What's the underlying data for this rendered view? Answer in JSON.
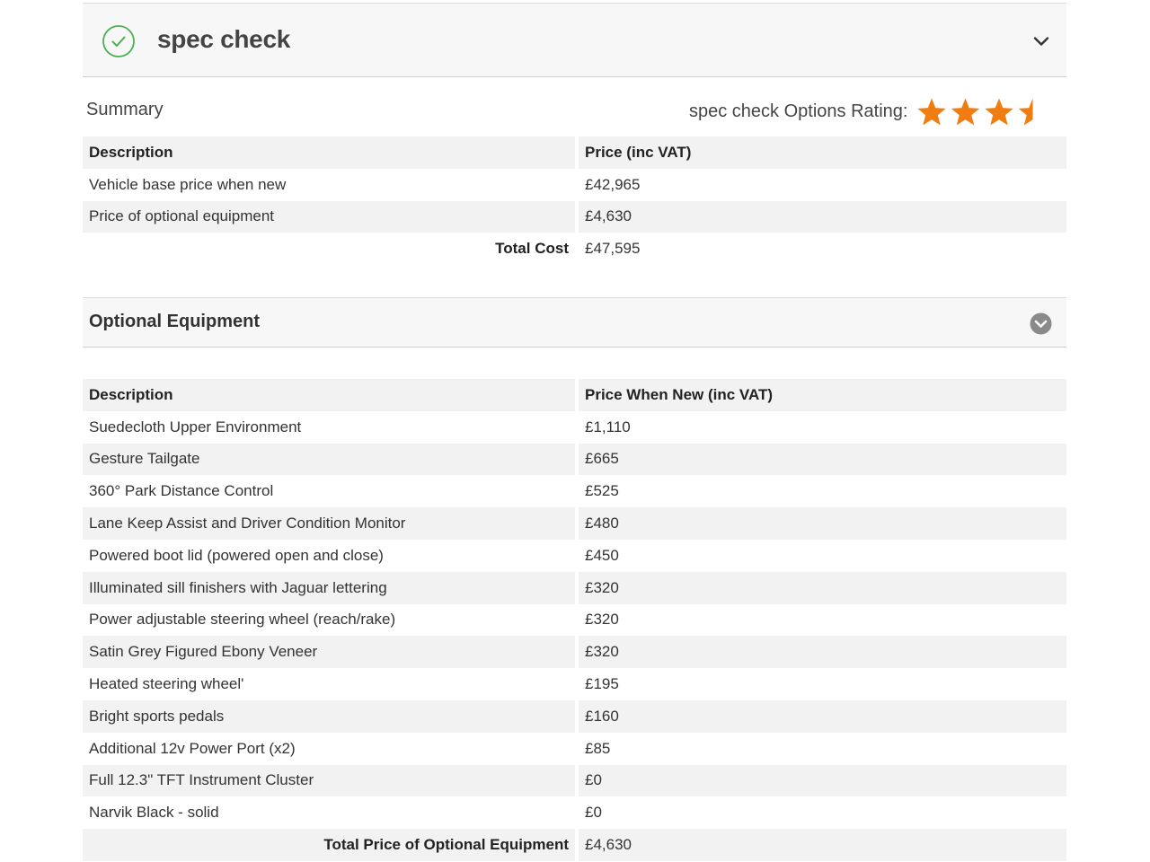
{
  "header": {
    "title": "spec check"
  },
  "summary": {
    "label": "Summary",
    "rating_label": "spec check Options Rating:",
    "rating": 3.5,
    "rating_max": 4,
    "columns": [
      "Description",
      "Price (inc VAT)"
    ],
    "rows": [
      {
        "desc": "Vehicle base price when new",
        "price": "£42,965"
      },
      {
        "desc": "Price of optional equipment",
        "price": "£4,630"
      }
    ],
    "total_label": "Total Cost",
    "total_value": "£47,595"
  },
  "optional": {
    "title": "Optional Equipment",
    "columns": [
      "Description",
      "Price When New (inc VAT)"
    ],
    "rows": [
      {
        "desc": "Suedecloth Upper Environment",
        "price": "£1,110"
      },
      {
        "desc": "Gesture Tailgate",
        "price": "£665"
      },
      {
        "desc": "360° Park Distance Control",
        "price": "£525"
      },
      {
        "desc": "Lane Keep Assist and Driver Condition Monitor",
        "price": "£480"
      },
      {
        "desc": "Powered boot lid (powered open and close)",
        "price": "£450"
      },
      {
        "desc": "Illuminated sill finishers with Jaguar lettering",
        "price": "£320"
      },
      {
        "desc": "Power adjustable steering wheel (reach/rake)",
        "price": "£320"
      },
      {
        "desc": "Satin Grey Figured Ebony Veneer",
        "price": "£320"
      },
      {
        "desc": "Heated steering wheel'",
        "price": "£195"
      },
      {
        "desc": "Bright sports pedals",
        "price": "£160"
      },
      {
        "desc": "Additional 12v Power Port (x2)",
        "price": "£85"
      },
      {
        "desc": "Full 12.3\" TFT Instrument Cluster",
        "price": "£0"
      },
      {
        "desc": "Narvik Black - solid",
        "price": "£0"
      }
    ],
    "total_label": "Total Price of Optional Equipment",
    "total_value": "£4,630"
  },
  "colors": {
    "accent_green": "#4caf50",
    "star_orange": "#f07d12",
    "icon_grey": "#8a8a8a"
  },
  "icons": {
    "header_check": "check-circle-icon",
    "header_chevron": "chevron-down-icon",
    "oe_chevron": "chevron-down-circle-icon",
    "star": "star-icon"
  }
}
